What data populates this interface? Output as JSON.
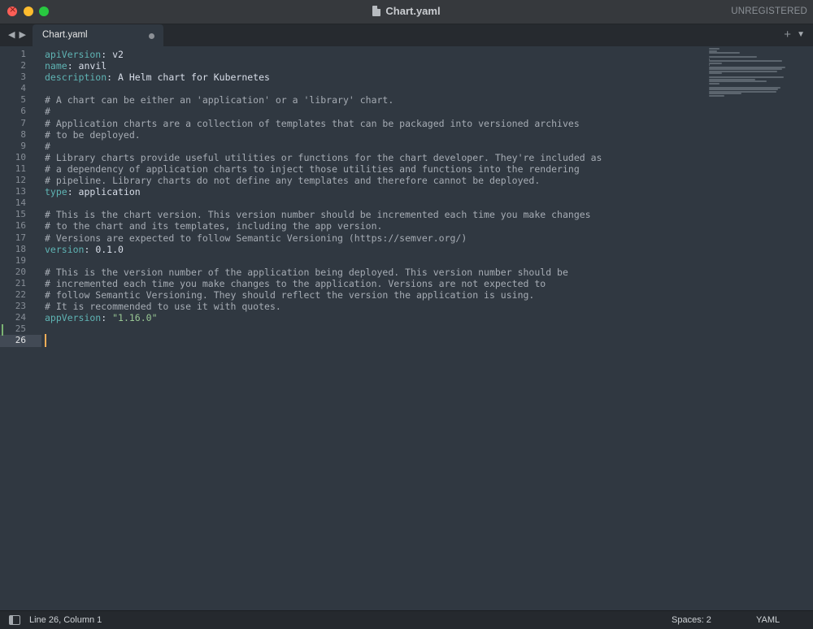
{
  "window": {
    "title": "Chart.yaml",
    "license_status": "UNREGISTERED"
  },
  "tabs": [
    {
      "label": "Chart.yaml",
      "modified": true
    }
  ],
  "editor": {
    "current_line": 26,
    "line_numbers": [
      "1",
      "2",
      "3",
      "4",
      "5",
      "6",
      "7",
      "8",
      "9",
      "10",
      "11",
      "12",
      "13",
      "14",
      "15",
      "16",
      "17",
      "18",
      "19",
      "20",
      "21",
      "22",
      "23",
      "24",
      "25",
      "26"
    ],
    "lines": [
      [
        {
          "t": "k",
          "v": "apiVersion"
        },
        {
          "t": "v",
          "v": ": v2"
        }
      ],
      [
        {
          "t": "k",
          "v": "name"
        },
        {
          "t": "v",
          "v": ": anvil"
        }
      ],
      [
        {
          "t": "k",
          "v": "description"
        },
        {
          "t": "v",
          "v": ": A Helm chart for Kubernetes"
        }
      ],
      [],
      [
        {
          "t": "c",
          "v": "# A chart can be either an 'application' or a 'library' chart."
        }
      ],
      [
        {
          "t": "c",
          "v": "#"
        }
      ],
      [
        {
          "t": "c",
          "v": "# Application charts are a collection of templates that can be packaged into versioned archives"
        }
      ],
      [
        {
          "t": "c",
          "v": "# to be deployed."
        }
      ],
      [
        {
          "t": "c",
          "v": "#"
        }
      ],
      [
        {
          "t": "c",
          "v": "# Library charts provide useful utilities or functions for the chart developer. They're included as"
        }
      ],
      [
        {
          "t": "c",
          "v": "# a dependency of application charts to inject those utilities and functions into the rendering"
        }
      ],
      [
        {
          "t": "c",
          "v": "# pipeline. Library charts do not define any templates and therefore cannot be deployed."
        }
      ],
      [
        {
          "t": "k",
          "v": "type"
        },
        {
          "t": "v",
          "v": ": application"
        }
      ],
      [],
      [
        {
          "t": "c",
          "v": "# This is the chart version. This version number should be incremented each time you make changes"
        }
      ],
      [
        {
          "t": "c",
          "v": "# to the chart and its templates, including the app version."
        }
      ],
      [
        {
          "t": "c",
          "v": "# Versions are expected to follow Semantic Versioning (https://semver.org/)"
        }
      ],
      [
        {
          "t": "k",
          "v": "version"
        },
        {
          "t": "v",
          "v": ": 0.1.0"
        }
      ],
      [],
      [
        {
          "t": "c",
          "v": "# This is the version number of the application being deployed. This version number should be"
        }
      ],
      [
        {
          "t": "c",
          "v": "# incremented each time you make changes to the application. Versions are not expected to"
        }
      ],
      [
        {
          "t": "c",
          "v": "# follow Semantic Versioning. They should reflect the version the application is using."
        }
      ],
      [
        {
          "t": "c",
          "v": "# It is recommended to use it with quotes."
        }
      ],
      [
        {
          "t": "k",
          "v": "appVersion"
        },
        {
          "t": "v",
          "v": ": "
        },
        {
          "t": "s",
          "v": "\"1.16.0\""
        }
      ],
      [],
      []
    ]
  },
  "statusbar": {
    "position": "Line 26, Column 1",
    "indentation": "Spaces: 2",
    "syntax": "YAML"
  },
  "colors": {
    "editor_bg": "#303841",
    "key": "#5fb4b4",
    "comment": "#a6acb4",
    "string": "#99c794",
    "caret": "#f9ae58"
  },
  "icons": [
    "file-icon",
    "back-arrow-icon",
    "forward-arrow-icon",
    "new-tab-plus-icon",
    "tab-menu-icon",
    "panel-toggle-icon"
  ]
}
